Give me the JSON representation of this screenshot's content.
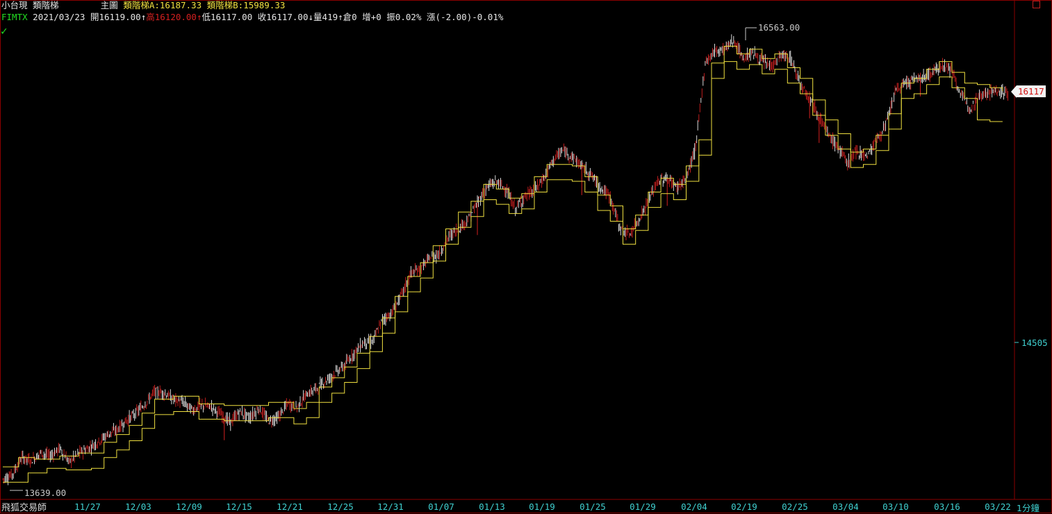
{
  "header": {
    "symbol_cn": "小台現",
    "indicator": "類階梯",
    "main_label": "主圖",
    "ladder_a_label": "類階梯A",
    "ladder_a_value": "16187.33",
    "ladder_b_label": "類階梯B",
    "ladder_b_value": "15989.33",
    "ticker": "FIMTX",
    "date": "2021/03/23",
    "open_label": "開",
    "open": "16119.00",
    "high_label": "高",
    "high": "16120.00",
    "low_label": "低",
    "low": "16117.00",
    "close_label": "收",
    "close": "16117.00",
    "volume_label": "量",
    "volume": "419",
    "oi_label": "倉",
    "oi": "0",
    "inc_label": "增",
    "inc": "+0",
    "amp_label": "振",
    "amp": "0.02%",
    "chg_label": "漲",
    "chg": "(-2.00)-0.01%",
    "up_arrow": "↑",
    "down_arrow": "↓"
  },
  "footer": {
    "brand": "飛狐交易師",
    "period": "1分鐘"
  },
  "colors": {
    "background": "#000000",
    "ladder": "#f0e040",
    "candle_up": "#d42020",
    "candle_down": "#f0f0f0",
    "axis_text": "#40d0d0",
    "frame": "#8b0000"
  },
  "chart_data": {
    "type": "candlestick",
    "x_ticks": [
      "11/27",
      "12/03",
      "12/09",
      "12/15",
      "12/21",
      "12/25",
      "12/31",
      "01/07",
      "01/13",
      "01/19",
      "01/25",
      "01/29",
      "02/04",
      "02/19",
      "02/25",
      "03/04",
      "03/10",
      "03/16",
      "03/22"
    ],
    "y_ticks": [
      "14505"
    ],
    "last_price": "16117",
    "high_annotation": "16563.00",
    "low_annotation": "13639.00",
    "ylim": [
      13600,
      16600
    ],
    "path_points": [
      [
        0,
        13660
      ],
      [
        3,
        13690
      ],
      [
        6,
        13800
      ],
      [
        9,
        13780
      ],
      [
        12,
        13830
      ],
      [
        15,
        13810
      ],
      [
        18,
        13860
      ],
      [
        21,
        13770
      ],
      [
        24,
        13830
      ],
      [
        27,
        13860
      ],
      [
        30,
        13900
      ],
      [
        33,
        13950
      ],
      [
        36,
        13980
      ],
      [
        39,
        14040
      ],
      [
        42,
        14090
      ],
      [
        45,
        14150
      ],
      [
        48,
        14230
      ],
      [
        51,
        14220
      ],
      [
        54,
        14180
      ],
      [
        57,
        14160
      ],
      [
        60,
        14110
      ],
      [
        63,
        14140
      ],
      [
        66,
        14130
      ],
      [
        69,
        14080
      ],
      [
        72,
        14030
      ],
      [
        75,
        14100
      ],
      [
        78,
        14060
      ],
      [
        81,
        14120
      ],
      [
        84,
        14040
      ],
      [
        87,
        14060
      ],
      [
        90,
        14150
      ],
      [
        93,
        14130
      ],
      [
        96,
        14210
      ],
      [
        99,
        14250
      ],
      [
        102,
        14300
      ],
      [
        105,
        14350
      ],
      [
        108,
        14400
      ],
      [
        111,
        14480
      ],
      [
        114,
        14550
      ],
      [
        117,
        14560
      ],
      [
        120,
        14700
      ],
      [
        123,
        14740
      ],
      [
        126,
        14860
      ],
      [
        129,
        15000
      ],
      [
        132,
        15030
      ],
      [
        135,
        15100
      ],
      [
        138,
        15130
      ],
      [
        141,
        15240
      ],
      [
        144,
        15290
      ],
      [
        147,
        15350
      ],
      [
        150,
        15460
      ],
      [
        153,
        15560
      ],
      [
        156,
        15600
      ],
      [
        159,
        15550
      ],
      [
        162,
        15420
      ],
      [
        165,
        15500
      ],
      [
        168,
        15540
      ],
      [
        171,
        15620
      ],
      [
        174,
        15740
      ],
      [
        177,
        15800
      ],
      [
        180,
        15760
      ],
      [
        183,
        15700
      ],
      [
        186,
        15640
      ],
      [
        189,
        15560
      ],
      [
        192,
        15500
      ],
      [
        195,
        15300
      ],
      [
        198,
        15250
      ],
      [
        201,
        15350
      ],
      [
        204,
        15470
      ],
      [
        207,
        15600
      ],
      [
        210,
        15620
      ],
      [
        213,
        15560
      ],
      [
        216,
        15620
      ],
      [
        219,
        15820
      ],
      [
        222,
        16370
      ],
      [
        225,
        16450
      ],
      [
        228,
        16460
      ],
      [
        231,
        16520
      ],
      [
        234,
        16400
      ],
      [
        237,
        16440
      ],
      [
        240,
        16380
      ],
      [
        243,
        16350
      ],
      [
        246,
        16420
      ],
      [
        249,
        16400
      ],
      [
        252,
        16240
      ],
      [
        255,
        16150
      ],
      [
        258,
        16020
      ],
      [
        261,
        15900
      ],
      [
        264,
        15820
      ],
      [
        267,
        15720
      ],
      [
        270,
        15800
      ],
      [
        273,
        15760
      ],
      [
        276,
        15860
      ],
      [
        279,
        15960
      ],
      [
        282,
        16180
      ],
      [
        285,
        16240
      ],
      [
        288,
        16260
      ],
      [
        291,
        16280
      ],
      [
        294,
        16310
      ],
      [
        297,
        16360
      ],
      [
        300,
        16320
      ],
      [
        303,
        16150
      ],
      [
        306,
        16080
      ],
      [
        309,
        16170
      ],
      [
        312,
        16180
      ],
      [
        315,
        16190
      ],
      [
        318,
        16170
      ]
    ],
    "ladder_a": [
      [
        0,
        13740
      ],
      [
        5,
        13740
      ],
      [
        5,
        13800
      ],
      [
        10,
        13800
      ],
      [
        10,
        13790
      ],
      [
        18,
        13790
      ],
      [
        18,
        13810
      ],
      [
        24,
        13810
      ],
      [
        24,
        13830
      ],
      [
        32,
        13830
      ],
      [
        32,
        13900
      ],
      [
        36,
        13900
      ],
      [
        36,
        13950
      ],
      [
        40,
        13950
      ],
      [
        40,
        14010
      ],
      [
        44,
        14010
      ],
      [
        44,
        14090
      ],
      [
        48,
        14090
      ],
      [
        48,
        14180
      ],
      [
        54,
        14180
      ],
      [
        54,
        14200
      ],
      [
        62,
        14200
      ],
      [
        62,
        14150
      ],
      [
        70,
        14150
      ],
      [
        70,
        14140
      ],
      [
        84,
        14140
      ],
      [
        84,
        14160
      ],
      [
        92,
        14160
      ],
      [
        92,
        14120
      ],
      [
        96,
        14120
      ],
      [
        96,
        14160
      ],
      [
        100,
        14160
      ],
      [
        100,
        14260
      ],
      [
        104,
        14260
      ],
      [
        104,
        14320
      ],
      [
        108,
        14320
      ],
      [
        108,
        14390
      ],
      [
        112,
        14390
      ],
      [
        112,
        14480
      ],
      [
        116,
        14480
      ],
      [
        116,
        14590
      ],
      [
        120,
        14590
      ],
      [
        120,
        14710
      ],
      [
        124,
        14710
      ],
      [
        124,
        14850
      ],
      [
        128,
        14850
      ],
      [
        128,
        14980
      ],
      [
        132,
        14980
      ],
      [
        132,
        15070
      ],
      [
        136,
        15070
      ],
      [
        136,
        15180
      ],
      [
        140,
        15180
      ],
      [
        140,
        15290
      ],
      [
        144,
        15290
      ],
      [
        144,
        15400
      ],
      [
        148,
        15400
      ],
      [
        148,
        15470
      ],
      [
        152,
        15470
      ],
      [
        152,
        15580
      ],
      [
        156,
        15580
      ],
      [
        156,
        15550
      ],
      [
        160,
        15550
      ],
      [
        160,
        15490
      ],
      [
        164,
        15490
      ],
      [
        164,
        15520
      ],
      [
        168,
        15520
      ],
      [
        168,
        15630
      ],
      [
        172,
        15630
      ],
      [
        172,
        15710
      ],
      [
        180,
        15710
      ],
      [
        180,
        15700
      ],
      [
        184,
        15700
      ],
      [
        184,
        15630
      ],
      [
        188,
        15630
      ],
      [
        188,
        15510
      ],
      [
        192,
        15510
      ],
      [
        192,
        15440
      ],
      [
        196,
        15440
      ],
      [
        196,
        15290
      ],
      [
        200,
        15290
      ],
      [
        200,
        15380
      ],
      [
        204,
        15380
      ],
      [
        204,
        15530
      ],
      [
        208,
        15530
      ],
      [
        208,
        15620
      ],
      [
        212,
        15620
      ],
      [
        212,
        15580
      ],
      [
        216,
        15580
      ],
      [
        216,
        15700
      ],
      [
        220,
        15700
      ],
      [
        220,
        15870
      ],
      [
        224,
        15870
      ],
      [
        224,
        16370
      ],
      [
        228,
        16370
      ],
      [
        228,
        16480
      ],
      [
        232,
        16480
      ],
      [
        232,
        16430
      ],
      [
        236,
        16430
      ],
      [
        236,
        16460
      ],
      [
        240,
        16460
      ],
      [
        240,
        16400
      ],
      [
        244,
        16400
      ],
      [
        244,
        16430
      ],
      [
        248,
        16430
      ],
      [
        248,
        16340
      ],
      [
        252,
        16340
      ],
      [
        252,
        16270
      ],
      [
        256,
        16270
      ],
      [
        256,
        16130
      ],
      [
        260,
        16130
      ],
      [
        260,
        16000
      ],
      [
        264,
        16000
      ],
      [
        264,
        15910
      ],
      [
        268,
        15910
      ],
      [
        268,
        15790
      ],
      [
        272,
        15790
      ],
      [
        272,
        15810
      ],
      [
        276,
        15810
      ],
      [
        276,
        15900
      ],
      [
        280,
        15900
      ],
      [
        280,
        16040
      ],
      [
        284,
        16040
      ],
      [
        284,
        16240
      ],
      [
        288,
        16240
      ],
      [
        288,
        16270
      ],
      [
        292,
        16270
      ],
      [
        292,
        16330
      ],
      [
        296,
        16330
      ],
      [
        296,
        16380
      ],
      [
        300,
        16380
      ],
      [
        300,
        16310
      ],
      [
        304,
        16310
      ],
      [
        304,
        16240
      ],
      [
        308,
        16240
      ],
      [
        308,
        16230
      ],
      [
        312,
        16230
      ],
      [
        312,
        16210
      ],
      [
        316,
        16210
      ],
      [
        316,
        16187
      ]
    ],
    "ladder_b": [
      [
        0,
        13640
      ],
      [
        8,
        13640
      ],
      [
        8,
        13700
      ],
      [
        14,
        13700
      ],
      [
        14,
        13730
      ],
      [
        20,
        13730
      ],
      [
        20,
        13720
      ],
      [
        28,
        13720
      ],
      [
        28,
        13730
      ],
      [
        32,
        13730
      ],
      [
        32,
        13800
      ],
      [
        36,
        13800
      ],
      [
        36,
        13850
      ],
      [
        40,
        13850
      ],
      [
        40,
        13910
      ],
      [
        44,
        13910
      ],
      [
        44,
        13990
      ],
      [
        48,
        13990
      ],
      [
        48,
        14080
      ],
      [
        54,
        14080
      ],
      [
        54,
        14100
      ],
      [
        62,
        14100
      ],
      [
        62,
        14050
      ],
      [
        70,
        14050
      ],
      [
        70,
        14040
      ],
      [
        84,
        14040
      ],
      [
        84,
        14060
      ],
      [
        92,
        14060
      ],
      [
        92,
        14020
      ],
      [
        96,
        14020
      ],
      [
        96,
        14060
      ],
      [
        100,
        14060
      ],
      [
        100,
        14160
      ],
      [
        104,
        14160
      ],
      [
        104,
        14220
      ],
      [
        108,
        14220
      ],
      [
        108,
        14290
      ],
      [
        112,
        14290
      ],
      [
        112,
        14380
      ],
      [
        116,
        14380
      ],
      [
        116,
        14490
      ],
      [
        120,
        14490
      ],
      [
        120,
        14610
      ],
      [
        124,
        14610
      ],
      [
        124,
        14750
      ],
      [
        128,
        14750
      ],
      [
        128,
        14880
      ],
      [
        132,
        14880
      ],
      [
        132,
        14970
      ],
      [
        136,
        14970
      ],
      [
        136,
        15080
      ],
      [
        140,
        15080
      ],
      [
        140,
        15190
      ],
      [
        144,
        15190
      ],
      [
        144,
        15300
      ],
      [
        148,
        15300
      ],
      [
        148,
        15370
      ],
      [
        152,
        15370
      ],
      [
        152,
        15480
      ],
      [
        156,
        15480
      ],
      [
        156,
        15450
      ],
      [
        160,
        15450
      ],
      [
        160,
        15390
      ],
      [
        164,
        15390
      ],
      [
        164,
        15420
      ],
      [
        168,
        15420
      ],
      [
        168,
        15530
      ],
      [
        172,
        15530
      ],
      [
        172,
        15610
      ],
      [
        180,
        15610
      ],
      [
        180,
        15600
      ],
      [
        184,
        15600
      ],
      [
        184,
        15530
      ],
      [
        188,
        15530
      ],
      [
        188,
        15410
      ],
      [
        192,
        15410
      ],
      [
        192,
        15340
      ],
      [
        196,
        15340
      ],
      [
        196,
        15190
      ],
      [
        200,
        15190
      ],
      [
        200,
        15280
      ],
      [
        204,
        15280
      ],
      [
        204,
        15430
      ],
      [
        208,
        15430
      ],
      [
        208,
        15520
      ],
      [
        212,
        15520
      ],
      [
        212,
        15480
      ],
      [
        216,
        15480
      ],
      [
        216,
        15600
      ],
      [
        220,
        15600
      ],
      [
        220,
        15770
      ],
      [
        224,
        15770
      ],
      [
        224,
        16270
      ],
      [
        228,
        16270
      ],
      [
        228,
        16380
      ],
      [
        232,
        16380
      ],
      [
        232,
        16330
      ],
      [
        236,
        16330
      ],
      [
        236,
        16360
      ],
      [
        240,
        16360
      ],
      [
        240,
        16300
      ],
      [
        244,
        16300
      ],
      [
        244,
        16330
      ],
      [
        248,
        16330
      ],
      [
        248,
        16240
      ],
      [
        252,
        16240
      ],
      [
        252,
        16170
      ],
      [
        256,
        16170
      ],
      [
        256,
        16030
      ],
      [
        260,
        16030
      ],
      [
        260,
        15900
      ],
      [
        264,
        15900
      ],
      [
        264,
        15810
      ],
      [
        268,
        15810
      ],
      [
        268,
        15690
      ],
      [
        272,
        15690
      ],
      [
        272,
        15710
      ],
      [
        276,
        15710
      ],
      [
        276,
        15800
      ],
      [
        280,
        15800
      ],
      [
        280,
        15940
      ],
      [
        284,
        15940
      ],
      [
        284,
        16140
      ],
      [
        288,
        16140
      ],
      [
        288,
        16170
      ],
      [
        292,
        16170
      ],
      [
        292,
        16230
      ],
      [
        296,
        16230
      ],
      [
        296,
        16280
      ],
      [
        300,
        16280
      ],
      [
        300,
        16210
      ],
      [
        304,
        16210
      ],
      [
        304,
        16140
      ],
      [
        308,
        16140
      ],
      [
        308,
        16000
      ],
      [
        312,
        16000
      ],
      [
        312,
        15989
      ],
      [
        316,
        15989
      ]
    ]
  }
}
